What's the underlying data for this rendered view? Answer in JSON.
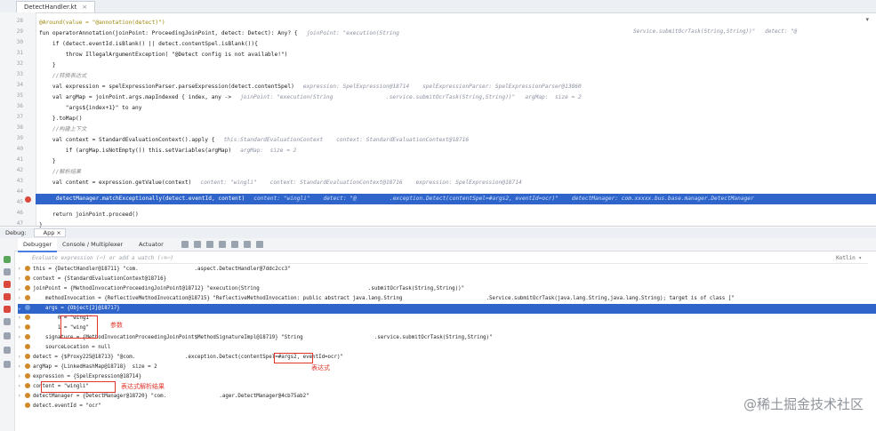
{
  "editor": {
    "tab_title": "DetectHandler.kt",
    "top_right": "▾",
    "line_numbers": [
      "28",
      "29",
      "30",
      "31",
      "32",
      "33",
      "34",
      "35",
      "36",
      "37",
      "38",
      "39",
      "40",
      "41",
      "42",
      "43",
      "44",
      "45",
      "46",
      "47"
    ],
    "lines": [
      "@Around(value = \"@annotation(detect)\")",
      "fun operatorAnnotation(joinPoint: ProceedingJoinPoint, detect: Detect): Any? {",
      "    if (detect.eventId.isBlank() || detect.contentSpel.isBlank()){",
      "        throw IllegalArgumentException( \"@Detect config is not available!\")",
      "    }",
      "    //转换表达式",
      "    val expression = spelExpressionParser.parseExpression(detect.contentSpel)",
      "    val argMap = joinPoint.args.mapIndexed { index, any ->",
      "        \"args${index+1}\" to any",
      "    }.toMap()",
      "    //构建上下文",
      "    val context = StandardEvaluationContext().apply {",
      "        if (argMap.isNotEmpty()) this.setVariables(argMap)",
      "    }",
      "    //解析结果",
      "    val content = expression.getValue(context)",
      "",
      "    detectManager.matchExceptionally(detect.eventId, content)",
      "    return joinPoint.proceed()",
      "}"
    ],
    "hints": {
      "l1": "joinPoint: \"execution(String",
      "l1r": "Service.submitOcrTask(String,String))\"   detect: \"@",
      "l6": "expression: SpelExpression@18714    spelExpressionParser: SpelExpressionParser@13860",
      "l7": "joinPoint: \"execution(String                .service.submitOcrTask(String,String))\"   argMap:  size = 2",
      "l11": "this:StandardEvaluationContext    context: StandardEvaluationContext@18716",
      "l12": "argMap:  size = 2",
      "l15": "content: \"wingli\"    context: StandardEvaluationContext@18716    expression: SpelExpression@18714",
      "l17": "content: \"wingli\"    detect: \"@          .exception.Detect(contentSpel=#args2, eventId=ocr)\"    detectManager: com.xxxxx.bus.base.manager.DetectManager"
    }
  },
  "debug": {
    "title": "Debug:",
    "session": "App",
    "tabs": [
      "Debugger",
      "Console / Multiplexer",
      "Actuator"
    ],
    "eval_placeholder": "Evaluate expression (⏎) or add a watch (⇧⌘⏎)",
    "eval_right": "Kotlin ▾",
    "variables": [
      {
        "expand": "›",
        "color": "#d08a2a",
        "text": "this = {DetectHandler@18711} \"com.                  .aspect.DetectHandler@7ddc2cc3\""
      },
      {
        "expand": "›",
        "color": "#d08a2a",
        "text": "context = {StandardEvaluationContext@18716}"
      },
      {
        "expand": "⌄",
        "color": "#d08a2a",
        "text": "joinPoint = {MethodInvocationProceedingJoinPoint@18712} \"execution(String                                   .submitOcrTask(String,String))\""
      },
      {
        "expand": "›",
        "color": "#d08a2a",
        "text": "    methodInvocation = {ReflectiveMethodInvocation@18715} \"ReflectiveMethodInvocation: public abstract java.lang.String                           .Service.submitOcrTask(java.lang.String,java.lang.String); target is of class [\""
      },
      {
        "expand": "⌄",
        "color": "#6d9be0",
        "text": "    args = {Object[2]@18717}",
        "selected": true
      },
      {
        "expand": "›",
        "color": "#d08a2a",
        "text": "        0 = \"wing1\""
      },
      {
        "expand": "›",
        "color": "#d08a2a",
        "text": "        1 = \"wing\""
      },
      {
        "expand": "›",
        "color": "#d08a2a",
        "text": "    signature = {MethodInvocationProceedingJoinPoint$MethodSignatureImpl@18719} \"String                       .service.submitOcrTask(String,String)\""
      },
      {
        "expand": " ",
        "color": "#d08a2a",
        "text": "    sourceLocation = null"
      },
      {
        "expand": "›",
        "color": "#d08a2a",
        "text": "detect = {$Proxy225@18713} \"@com.                .exception.Detect(contentSpel=#args2, eventId=ocr)\""
      },
      {
        "expand": "›",
        "color": "#d08a2a",
        "text": "argMap = {LinkedHashMap@18718}  size = 2"
      },
      {
        "expand": "›",
        "color": "#d08a2a",
        "text": "expression = {SpelExpression@18714}"
      },
      {
        "expand": "›",
        "color": "#d08a2a",
        "text": "content = \"wingli\""
      },
      {
        "expand": "›",
        "color": "#d08a2a",
        "text": "detectManager = {DetectManager@18720} \"com.                 .ager.DetectManager@4cb75ab2\""
      },
      {
        "expand": " ",
        "color": "#d08a2a",
        "text": "detect.eventId = \"ocr\""
      }
    ],
    "labels": {
      "params": "参数",
      "expression": "表达式",
      "result": "表达式解析结果"
    }
  },
  "watermark": "@稀土掘金技术社区",
  "colors": {
    "selection": "#2f65ca",
    "annotation_red": "#e2352b",
    "breakpoint": "#d9473d"
  }
}
